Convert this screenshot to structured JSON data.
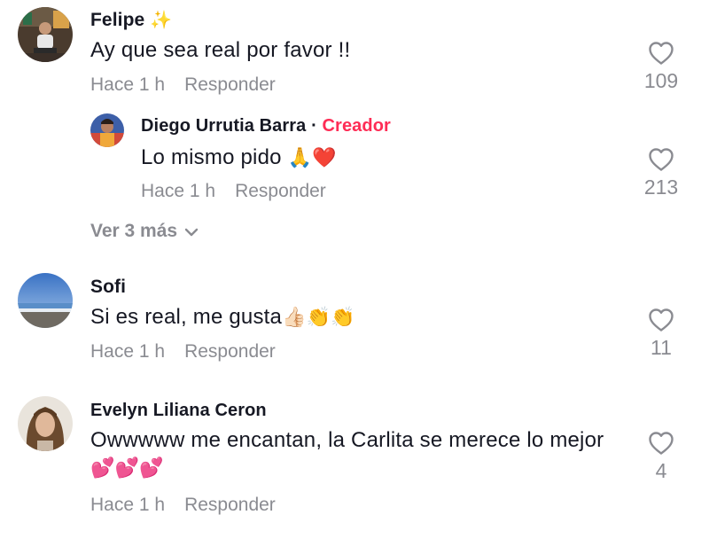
{
  "comments": [
    {
      "user": "Felipe",
      "badge": "✨",
      "text": "Ay que sea real por favor !!",
      "time": "Hace 1 h",
      "reply_label": "Responder",
      "likes": "109",
      "reply": {
        "user": "Diego Urrutia Barra",
        "separator": "·",
        "role": "Creador",
        "text": "Lo mismo pido",
        "emojis": "🙏❤️",
        "time": "Hace 1 h",
        "reply_label": "Responder",
        "likes": "213"
      },
      "view_more": "Ver 3 más"
    },
    {
      "user": "Sofi",
      "text": "Si es real, me gusta",
      "emojis": "👍🏻👏👏",
      "time": "Hace 1 h",
      "reply_label": "Responder",
      "likes": "11"
    },
    {
      "user": "Evelyn Liliana Ceron",
      "text": "Owwwww me encantan, la Carlita se merece lo mejor",
      "emojis": "💕💕💕",
      "time": "Hace 1 h",
      "reply_label": "Responder",
      "likes": "4"
    }
  ],
  "colors": {
    "creator": "#fe2c55",
    "muted": "#8a8b91",
    "text": "#161823"
  },
  "icons": [
    "heart-outline-icon",
    "chevron-down-icon"
  ]
}
